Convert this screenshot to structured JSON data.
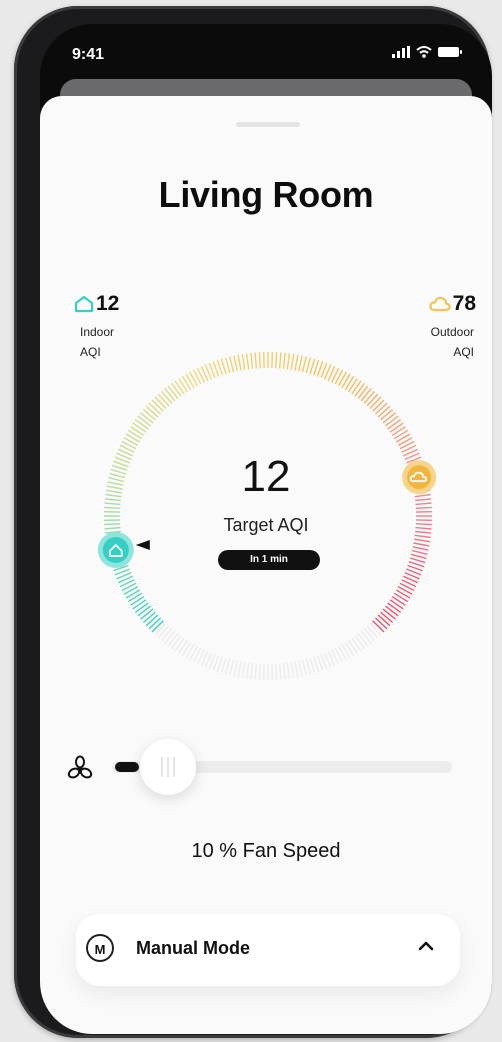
{
  "status_bar": {
    "time": "9:41",
    "signal_icon": "signal-bars-icon",
    "wifi_icon": "wifi-icon",
    "battery_icon": "battery-icon"
  },
  "room": {
    "title": "Living Room"
  },
  "indoor": {
    "value": "12",
    "label_line1": "Indoor",
    "label_line2": "AQI",
    "icon": "house-icon",
    "color": "#35d0c3"
  },
  "outdoor": {
    "value": "78",
    "label_line1": "Outdoor",
    "label_line2": "AQI",
    "icon": "cloud-icon",
    "color": "#f2c35b"
  },
  "dial": {
    "target_value": "12",
    "target_label": "Target AQI",
    "eta": "In 1 min",
    "indoor_marker_value": 12,
    "outdoor_marker_value": 78,
    "gradient_colors": [
      "#35d0c3",
      "#b5dda0",
      "#f2d77c",
      "#f2c35b",
      "#ef8793",
      "#ea4f6d"
    ],
    "inactive_color": "#ececec"
  },
  "fan": {
    "icon": "fan-icon",
    "speed_label": "10 % Fan Speed",
    "speed_percent": 10
  },
  "mode": {
    "badge": "M",
    "label": "Manual Mode",
    "icon": "chevron-up-icon"
  }
}
